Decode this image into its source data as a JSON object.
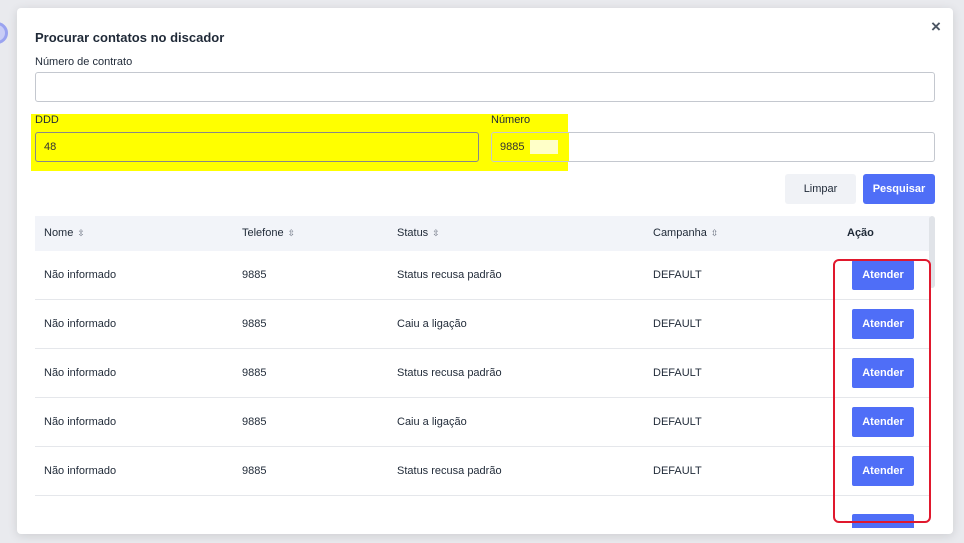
{
  "modal": {
    "title": "Procurar contatos no discador",
    "close_glyph": "×"
  },
  "form": {
    "contract_label": "Número de contrato",
    "contract_value": "",
    "ddd_label": "DDD",
    "ddd_value": "48",
    "numero_label": "Número",
    "numero_value": "9885"
  },
  "buttons": {
    "clear_label": "Limpar",
    "search_label": "Pesquisar"
  },
  "table": {
    "columns": [
      "Nome",
      "Telefone",
      "Status",
      "Campanha",
      "Ação"
    ],
    "sort_glyph": "⇳",
    "action_label": "Atender",
    "rows": [
      {
        "nome": "Não informado",
        "telefone": "9885",
        "status": "Status recusa padrão",
        "campanha": "DEFAULT"
      },
      {
        "nome": "Não informado",
        "telefone": "9885",
        "status": "Caiu a ligação",
        "campanha": "DEFAULT"
      },
      {
        "nome": "Não informado",
        "telefone": "9885",
        "status": "Status recusa padrão",
        "campanha": "DEFAULT"
      },
      {
        "nome": "Não informado",
        "telefone": "9885",
        "status": "Caiu a ligação",
        "campanha": "DEFAULT"
      },
      {
        "nome": "Não informado",
        "telefone": "9885",
        "status": "Status recusa padrão",
        "campanha": "DEFAULT"
      }
    ]
  },
  "colors": {
    "primary": "#4f6ef7",
    "highlight": "#ffff00",
    "annotation": "#e0182d"
  }
}
